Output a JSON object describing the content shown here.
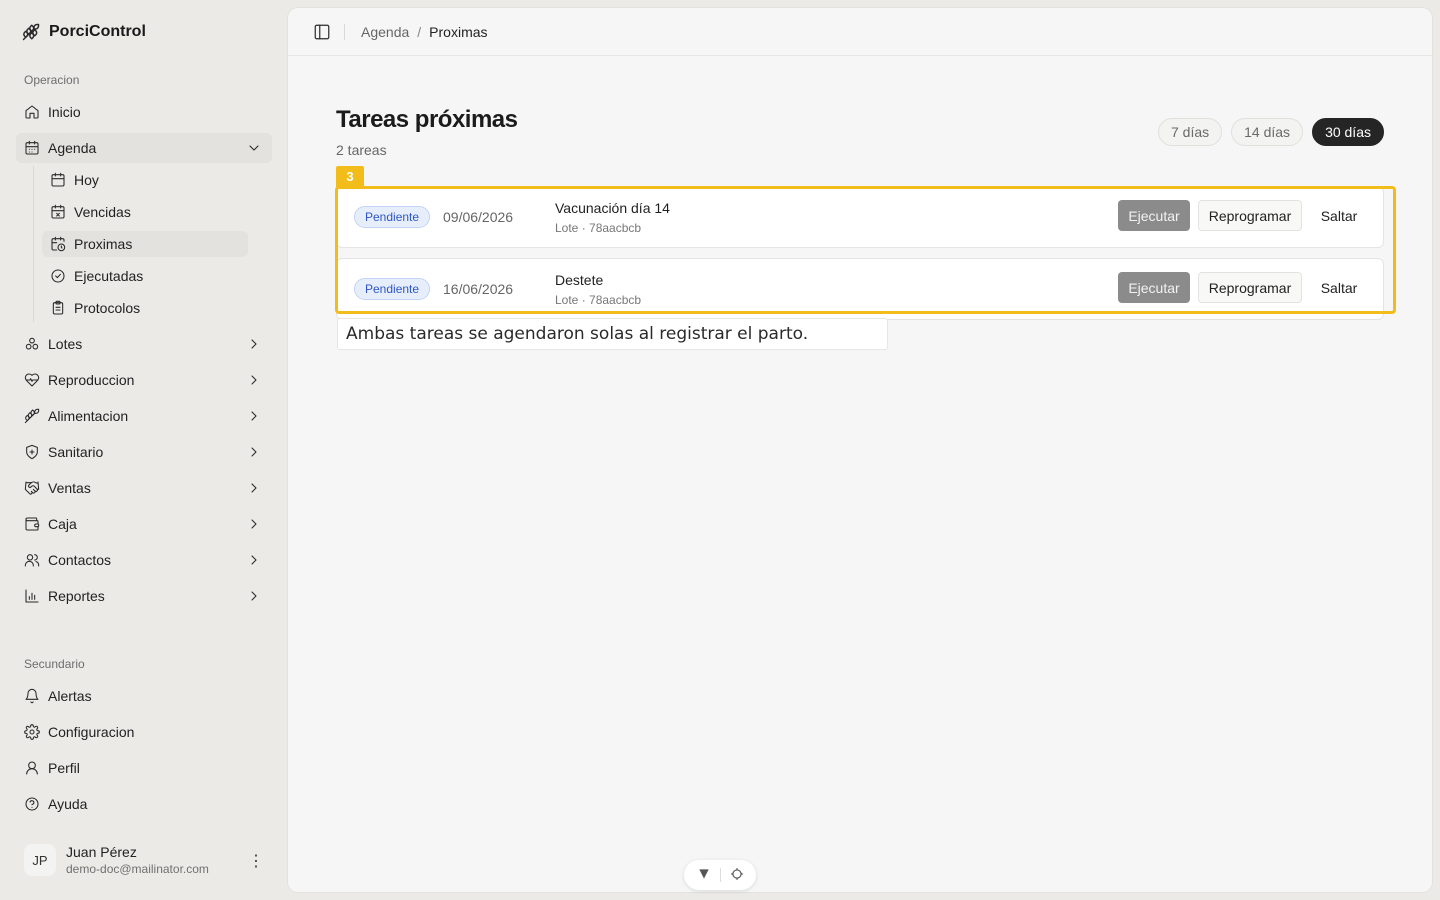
{
  "app": {
    "name": "PorciControl",
    "logo_icon": "wheat-icon"
  },
  "sidebar": {
    "section_primary": "Operacion",
    "inicio": "Inicio",
    "agenda": "Agenda",
    "agenda_sub": {
      "hoy": "Hoy",
      "vencidas": "Vencidas",
      "proximas": "Proximas",
      "ejecutadas": "Ejecutadas",
      "protocolos": "Protocolos"
    },
    "lotes": "Lotes",
    "reproduccion": "Reproduccion",
    "alimentacion": "Alimentacion",
    "sanitario": "Sanitario",
    "ventas": "Ventas",
    "caja": "Caja",
    "contactos": "Contactos",
    "reportes": "Reportes",
    "section_secondary": "Secundario",
    "alertas": "Alertas",
    "configuracion": "Configuracion",
    "perfil": "Perfil",
    "ayuda": "Ayuda"
  },
  "user": {
    "initials": "JP",
    "name": "Juan Pérez",
    "email": "demo-doc@mailinator.com",
    "menu": "⋮"
  },
  "breadcrumb": {
    "parent": "Agenda",
    "separator": "/",
    "current": "Proximas"
  },
  "page": {
    "title": "Tareas próximas",
    "subtitle": "2 tareas",
    "filters": [
      "7 días",
      "14 días",
      "30 días"
    ],
    "active_filter": "30 días"
  },
  "tasks": [
    {
      "status": "Pendiente",
      "date": "09/06/2026",
      "title": "Vacunación día 14",
      "meta": "Lote · 78aacbcb",
      "actions": {
        "execute": "Ejecutar",
        "reschedule": "Reprogramar",
        "skip": "Saltar"
      }
    },
    {
      "status": "Pendiente",
      "date": "16/06/2026",
      "title": "Destete",
      "meta": "Lote · 78aacbcb",
      "actions": {
        "execute": "Ejecutar",
        "reschedule": "Reprogramar",
        "skip": "Saltar"
      }
    }
  ],
  "annotation": {
    "tag": "3",
    "caption": "Ambas tareas se agendaron solas al registrar el parto.",
    "color": "#f2bd1b"
  },
  "colors": {
    "badge_bg": "#e6eefc",
    "badge_text": "#2f56c4",
    "active_pill": "#252525",
    "execute_btn": "#8b8b8b"
  }
}
